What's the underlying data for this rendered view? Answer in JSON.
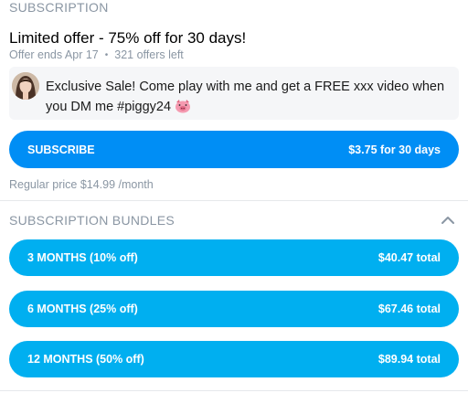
{
  "subscription": {
    "header": "SUBSCRIPTION",
    "offer_title": "Limited offer - 75% off for 30 days!",
    "offer_ends": "Offer ends Apr 17",
    "separator": "•",
    "offers_left": "321 offers left",
    "message": "Exclusive Sale! Come play with me and get a FREE xxx video when you DM me #piggy24",
    "message_emoji": "pig-face-icon",
    "subscribe_label": "SUBSCRIBE",
    "subscribe_price": "$3.75 for 30 days",
    "regular_price": "Regular price $14.99 /month"
  },
  "bundles": {
    "header": "SUBSCRIPTION BUNDLES",
    "toggle_icon": "chevron-up-icon",
    "items": [
      {
        "label": "3 MONTHS (10% off)",
        "price": "$40.47 total"
      },
      {
        "label": "6 MONTHS (25% off)",
        "price": "$67.46 total"
      },
      {
        "label": "12 MONTHS (50% off)",
        "price": "$89.94 total"
      }
    ]
  },
  "colors": {
    "primary_button": "#008ef5",
    "bundle_button": "#00aff0",
    "muted_text": "#8a96a3"
  }
}
